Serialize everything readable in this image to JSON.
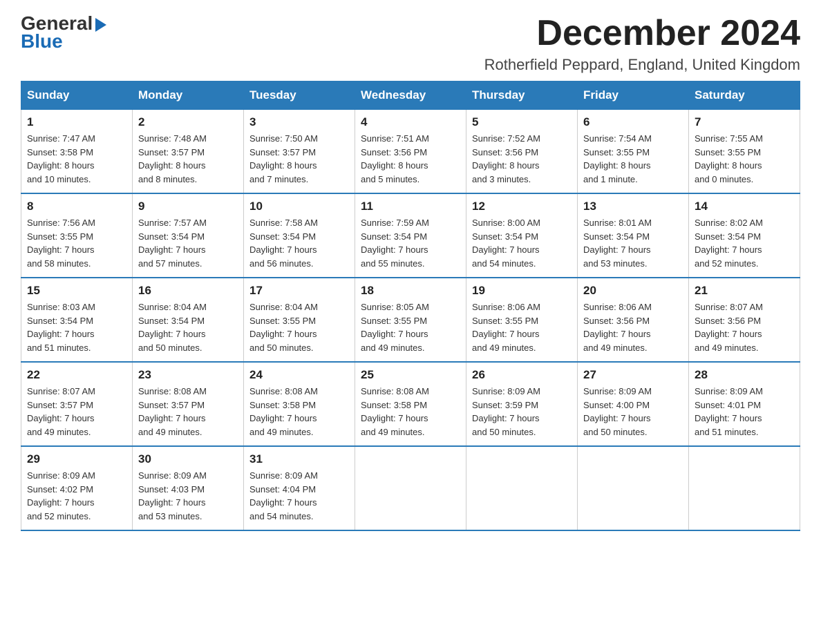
{
  "header": {
    "logo_general": "General",
    "logo_blue": "Blue",
    "month_title": "December 2024",
    "subtitle": "Rotherfield Peppard, England, United Kingdom"
  },
  "days_of_week": [
    "Sunday",
    "Monday",
    "Tuesday",
    "Wednesday",
    "Thursday",
    "Friday",
    "Saturday"
  ],
  "weeks": [
    [
      {
        "day": "1",
        "sunrise": "7:47 AM",
        "sunset": "3:58 PM",
        "daylight": "8 hours and 10 minutes."
      },
      {
        "day": "2",
        "sunrise": "7:48 AM",
        "sunset": "3:57 PM",
        "daylight": "8 hours and 8 minutes."
      },
      {
        "day": "3",
        "sunrise": "7:50 AM",
        "sunset": "3:57 PM",
        "daylight": "8 hours and 7 minutes."
      },
      {
        "day": "4",
        "sunrise": "7:51 AM",
        "sunset": "3:56 PM",
        "daylight": "8 hours and 5 minutes."
      },
      {
        "day": "5",
        "sunrise": "7:52 AM",
        "sunset": "3:56 PM",
        "daylight": "8 hours and 3 minutes."
      },
      {
        "day": "6",
        "sunrise": "7:54 AM",
        "sunset": "3:55 PM",
        "daylight": "8 hours and 1 minute."
      },
      {
        "day": "7",
        "sunrise": "7:55 AM",
        "sunset": "3:55 PM",
        "daylight": "8 hours and 0 minutes."
      }
    ],
    [
      {
        "day": "8",
        "sunrise": "7:56 AM",
        "sunset": "3:55 PM",
        "daylight": "7 hours and 58 minutes."
      },
      {
        "day": "9",
        "sunrise": "7:57 AM",
        "sunset": "3:54 PM",
        "daylight": "7 hours and 57 minutes."
      },
      {
        "day": "10",
        "sunrise": "7:58 AM",
        "sunset": "3:54 PM",
        "daylight": "7 hours and 56 minutes."
      },
      {
        "day": "11",
        "sunrise": "7:59 AM",
        "sunset": "3:54 PM",
        "daylight": "7 hours and 55 minutes."
      },
      {
        "day": "12",
        "sunrise": "8:00 AM",
        "sunset": "3:54 PM",
        "daylight": "7 hours and 54 minutes."
      },
      {
        "day": "13",
        "sunrise": "8:01 AM",
        "sunset": "3:54 PM",
        "daylight": "7 hours and 53 minutes."
      },
      {
        "day": "14",
        "sunrise": "8:02 AM",
        "sunset": "3:54 PM",
        "daylight": "7 hours and 52 minutes."
      }
    ],
    [
      {
        "day": "15",
        "sunrise": "8:03 AM",
        "sunset": "3:54 PM",
        "daylight": "7 hours and 51 minutes."
      },
      {
        "day": "16",
        "sunrise": "8:04 AM",
        "sunset": "3:54 PM",
        "daylight": "7 hours and 50 minutes."
      },
      {
        "day": "17",
        "sunrise": "8:04 AM",
        "sunset": "3:55 PM",
        "daylight": "7 hours and 50 minutes."
      },
      {
        "day": "18",
        "sunrise": "8:05 AM",
        "sunset": "3:55 PM",
        "daylight": "7 hours and 49 minutes."
      },
      {
        "day": "19",
        "sunrise": "8:06 AM",
        "sunset": "3:55 PM",
        "daylight": "7 hours and 49 minutes."
      },
      {
        "day": "20",
        "sunrise": "8:06 AM",
        "sunset": "3:56 PM",
        "daylight": "7 hours and 49 minutes."
      },
      {
        "day": "21",
        "sunrise": "8:07 AM",
        "sunset": "3:56 PM",
        "daylight": "7 hours and 49 minutes."
      }
    ],
    [
      {
        "day": "22",
        "sunrise": "8:07 AM",
        "sunset": "3:57 PM",
        "daylight": "7 hours and 49 minutes."
      },
      {
        "day": "23",
        "sunrise": "8:08 AM",
        "sunset": "3:57 PM",
        "daylight": "7 hours and 49 minutes."
      },
      {
        "day": "24",
        "sunrise": "8:08 AM",
        "sunset": "3:58 PM",
        "daylight": "7 hours and 49 minutes."
      },
      {
        "day": "25",
        "sunrise": "8:08 AM",
        "sunset": "3:58 PM",
        "daylight": "7 hours and 49 minutes."
      },
      {
        "day": "26",
        "sunrise": "8:09 AM",
        "sunset": "3:59 PM",
        "daylight": "7 hours and 50 minutes."
      },
      {
        "day": "27",
        "sunrise": "8:09 AM",
        "sunset": "4:00 PM",
        "daylight": "7 hours and 50 minutes."
      },
      {
        "day": "28",
        "sunrise": "8:09 AM",
        "sunset": "4:01 PM",
        "daylight": "7 hours and 51 minutes."
      }
    ],
    [
      {
        "day": "29",
        "sunrise": "8:09 AM",
        "sunset": "4:02 PM",
        "daylight": "7 hours and 52 minutes."
      },
      {
        "day": "30",
        "sunrise": "8:09 AM",
        "sunset": "4:03 PM",
        "daylight": "7 hours and 53 minutes."
      },
      {
        "day": "31",
        "sunrise": "8:09 AM",
        "sunset": "4:04 PM",
        "daylight": "7 hours and 54 minutes."
      },
      null,
      null,
      null,
      null
    ]
  ],
  "labels": {
    "sunrise": "Sunrise: ",
    "sunset": "Sunset: ",
    "daylight": "Daylight: "
  }
}
